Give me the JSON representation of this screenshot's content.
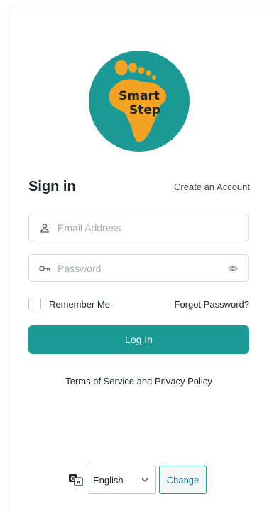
{
  "logo": {
    "line1": "Smart",
    "line2": "Step",
    "circle_color": "#1b9a95",
    "africa_color": "#f2a324"
  },
  "header": {
    "title": "Sign in",
    "create_account": "Create an Account"
  },
  "email": {
    "placeholder": "Email Address",
    "value": ""
  },
  "password": {
    "placeholder": "Password",
    "value": ""
  },
  "remember": {
    "label": "Remember Me",
    "checked": false
  },
  "forgot": {
    "label": "Forgot Password?"
  },
  "login": {
    "label": "Log In"
  },
  "terms": {
    "label": "Terms of Service and Privacy Policy"
  },
  "language": {
    "selected": "English",
    "change_label": "Change"
  },
  "colors": {
    "accent": "#1b9a95"
  }
}
